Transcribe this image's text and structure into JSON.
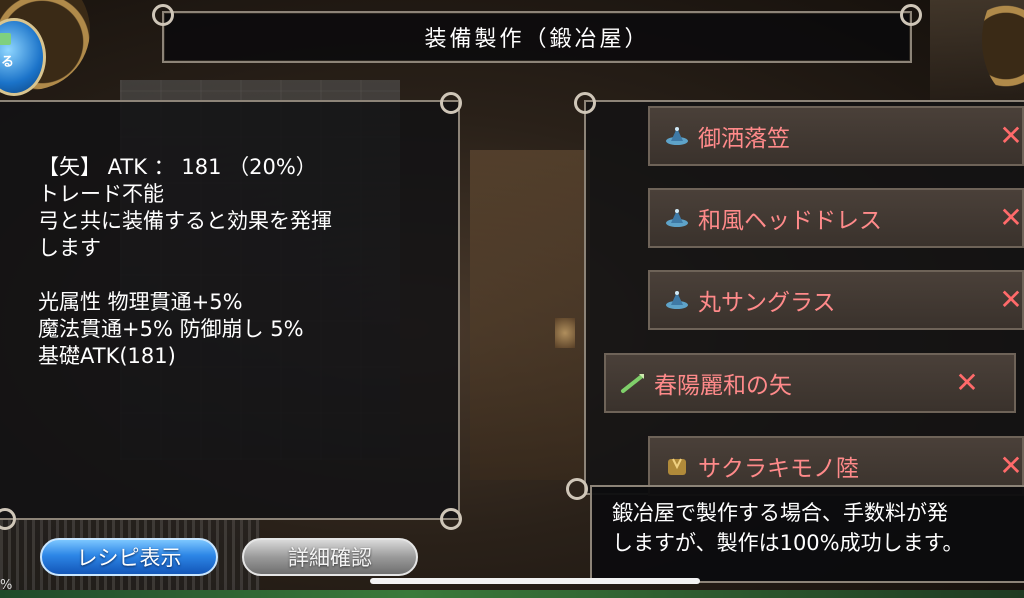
{
  "header": {
    "title": "装備製作（鍛冶屋）"
  },
  "back_button": {
    "label": "る"
  },
  "description": {
    "lines": [
      "【矢】 ATK ： 181 （20%）",
      "トレード不能",
      "弓と共に装備すると効果を発揮",
      "します",
      "",
      "光属性 物理貫通+5%",
      "魔法貫通+5% 防御崩し 5%",
      "基礎ATK(181)"
    ]
  },
  "buttons": {
    "recipe_label": "レシピ表示",
    "detail_label": "詳細確認"
  },
  "materials": [
    {
      "name": "御洒落笠",
      "icon": "hat-icon",
      "removable": true
    },
    {
      "name": "和風ヘッドドレス",
      "icon": "hat-icon",
      "removable": true
    },
    {
      "name": "丸サングラス",
      "icon": "hat-icon",
      "removable": true
    },
    {
      "name": "春陽麗和の矢",
      "icon": "arrow-icon",
      "removable": true
    },
    {
      "name": "サクラキモノ陸",
      "icon": "kimono-icon",
      "removable": true
    }
  ],
  "message": {
    "line1": "鍛冶屋で製作する場合、手数料が発",
    "line2": "しますが、製作は100%成功します。"
  },
  "corner_text": "%",
  "colors": {
    "item_name": "#ff8a8a",
    "remove_x": "#ff6a6a",
    "recipe_button": "#2d86e6",
    "panel_border": "#8d8478"
  }
}
